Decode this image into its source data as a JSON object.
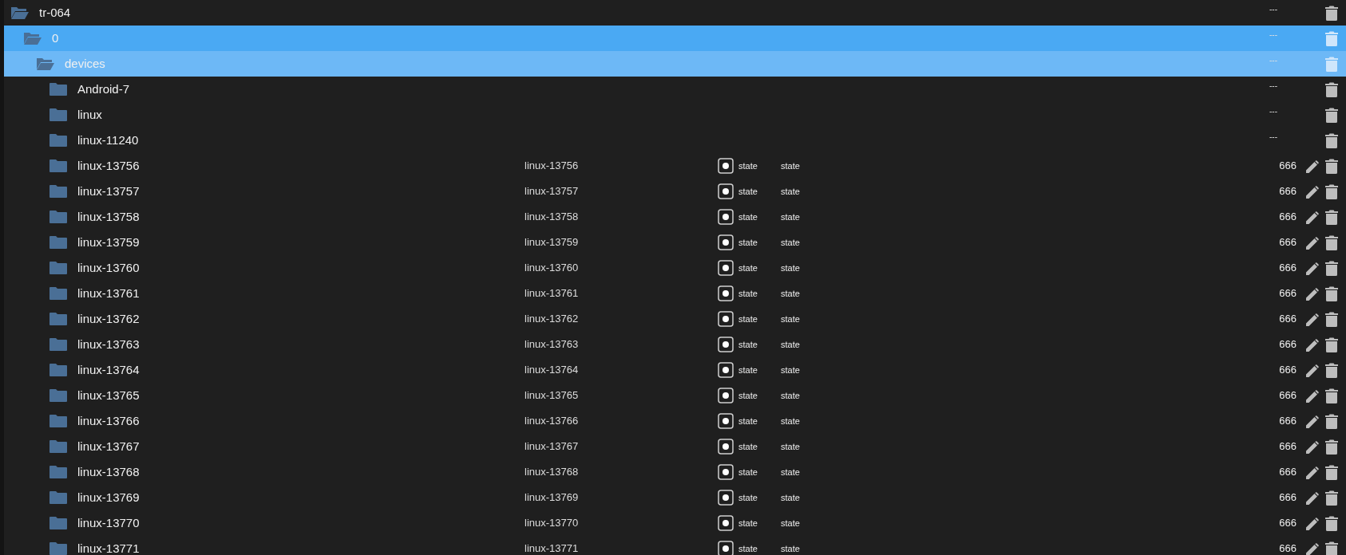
{
  "tree": [
    {
      "name": "tr-064",
      "expanded": true,
      "selected": false,
      "hovered": false,
      "acl": "---",
      "children": [
        {
          "name": "0",
          "expanded": true,
          "selected": true,
          "hovered": false,
          "acl": "---",
          "children": [
            {
              "name": "devices",
              "expanded": true,
              "selected": false,
              "hovered": true,
              "acl": "---",
              "children": [
                {
                  "name": "Android-7",
                  "kind": "folder",
                  "expanded": false,
                  "selected": false,
                  "hovered": false,
                  "acl": "---"
                },
                {
                  "name": "linux",
                  "kind": "folder",
                  "expanded": false,
                  "selected": false,
                  "hovered": false,
                  "acl": "---"
                },
                {
                  "name": "linux-11240",
                  "kind": "folder",
                  "expanded": false,
                  "selected": false,
                  "hovered": false,
                  "acl": "---"
                },
                {
                  "name": "linux-13756",
                  "kind": "object",
                  "expanded": false,
                  "selected": false,
                  "hovered": false,
                  "obj_name": "linux-13756",
                  "type": "state",
                  "role": "state",
                  "acl": "666"
                },
                {
                  "name": "linux-13757",
                  "kind": "object",
                  "expanded": false,
                  "selected": false,
                  "hovered": false,
                  "obj_name": "linux-13757",
                  "type": "state",
                  "role": "state",
                  "acl": "666"
                },
                {
                  "name": "linux-13758",
                  "kind": "object",
                  "expanded": false,
                  "selected": false,
                  "hovered": false,
                  "obj_name": "linux-13758",
                  "type": "state",
                  "role": "state",
                  "acl": "666"
                },
                {
                  "name": "linux-13759",
                  "kind": "object",
                  "expanded": false,
                  "selected": false,
                  "hovered": false,
                  "obj_name": "linux-13759",
                  "type": "state",
                  "role": "state",
                  "acl": "666"
                },
                {
                  "name": "linux-13760",
                  "kind": "object",
                  "expanded": false,
                  "selected": false,
                  "hovered": false,
                  "obj_name": "linux-13760",
                  "type": "state",
                  "role": "state",
                  "acl": "666"
                },
                {
                  "name": "linux-13761",
                  "kind": "object",
                  "expanded": false,
                  "selected": false,
                  "hovered": false,
                  "obj_name": "linux-13761",
                  "type": "state",
                  "role": "state",
                  "acl": "666"
                },
                {
                  "name": "linux-13762",
                  "kind": "object",
                  "expanded": false,
                  "selected": false,
                  "hovered": false,
                  "obj_name": "linux-13762",
                  "type": "state",
                  "role": "state",
                  "acl": "666"
                },
                {
                  "name": "linux-13763",
                  "kind": "object",
                  "expanded": false,
                  "selected": false,
                  "hovered": false,
                  "obj_name": "linux-13763",
                  "type": "state",
                  "role": "state",
                  "acl": "666"
                },
                {
                  "name": "linux-13764",
                  "kind": "object",
                  "expanded": false,
                  "selected": false,
                  "hovered": false,
                  "obj_name": "linux-13764",
                  "type": "state",
                  "role": "state",
                  "acl": "666"
                },
                {
                  "name": "linux-13765",
                  "kind": "object",
                  "expanded": false,
                  "selected": false,
                  "hovered": false,
                  "obj_name": "linux-13765",
                  "type": "state",
                  "role": "state",
                  "acl": "666"
                },
                {
                  "name": "linux-13766",
                  "kind": "object",
                  "expanded": false,
                  "selected": false,
                  "hovered": false,
                  "obj_name": "linux-13766",
                  "type": "state",
                  "role": "state",
                  "acl": "666"
                },
                {
                  "name": "linux-13767",
                  "kind": "object",
                  "expanded": false,
                  "selected": false,
                  "hovered": false,
                  "obj_name": "linux-13767",
                  "type": "state",
                  "role": "state",
                  "acl": "666"
                },
                {
                  "name": "linux-13768",
                  "kind": "object",
                  "expanded": false,
                  "selected": false,
                  "hovered": false,
                  "obj_name": "linux-13768",
                  "type": "state",
                  "role": "state",
                  "acl": "666"
                },
                {
                  "name": "linux-13769",
                  "kind": "object",
                  "expanded": false,
                  "selected": false,
                  "hovered": false,
                  "obj_name": "linux-13769",
                  "type": "state",
                  "role": "state",
                  "acl": "666"
                },
                {
                  "name": "linux-13770",
                  "kind": "object",
                  "expanded": false,
                  "selected": false,
                  "hovered": false,
                  "obj_name": "linux-13770",
                  "type": "state",
                  "role": "state",
                  "acl": "666"
                },
                {
                  "name": "linux-13771",
                  "kind": "object",
                  "expanded": false,
                  "selected": false,
                  "hovered": false,
                  "obj_name": "linux-13771",
                  "type": "state",
                  "role": "state",
                  "acl": "666"
                }
              ]
            }
          ]
        }
      ]
    }
  ]
}
